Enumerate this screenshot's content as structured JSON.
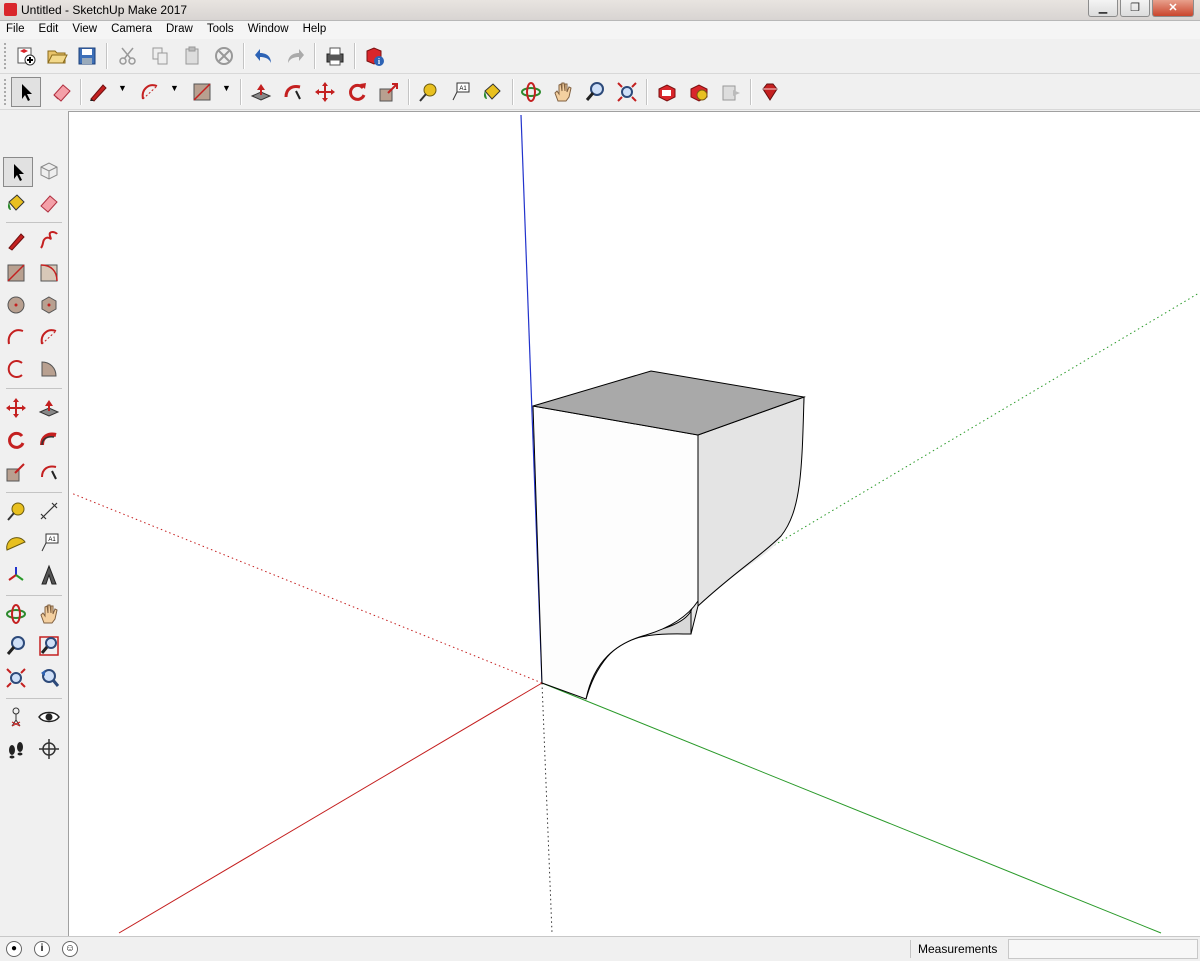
{
  "window": {
    "title": "Untitled - SketchUp Make 2017",
    "minimize": "▁",
    "maximize": "❐",
    "close": "✕"
  },
  "menu": [
    "File",
    "Edit",
    "View",
    "Camera",
    "Draw",
    "Tools",
    "Window",
    "Help"
  ],
  "toolbar_top": [
    "new-icon",
    "open-icon",
    "save-icon",
    "cut-icon",
    "copy-icon",
    "paste-icon",
    "erase-icon",
    "undo-icon",
    "redo-icon",
    "print-icon",
    "model-info-icon"
  ],
  "toolbar_main": [
    "select-icon",
    "eraser-icon",
    "pencil-icon",
    "arc-icon",
    "rectangle-icon",
    "push-pull-icon",
    "follow-me-icon",
    "move-icon",
    "rotate-icon",
    "scale-icon",
    "tape-measure-icon",
    "text-icon",
    "paint-bucket-icon",
    "orbit-icon",
    "pan-icon",
    "zoom-icon",
    "zoom-extents-icon",
    "3d-warehouse-icon",
    "extension-warehouse-icon",
    "layout-icon",
    "ruby-icon"
  ],
  "status": {
    "measurements_label": "Measurements",
    "measurements_value": ""
  },
  "colors": {
    "axis_red": "#c41e1e",
    "axis_green": "#2a9a2a",
    "axis_blue": "#2233cc",
    "top_face": "#a9a9a9",
    "accent": "#d9262b"
  }
}
